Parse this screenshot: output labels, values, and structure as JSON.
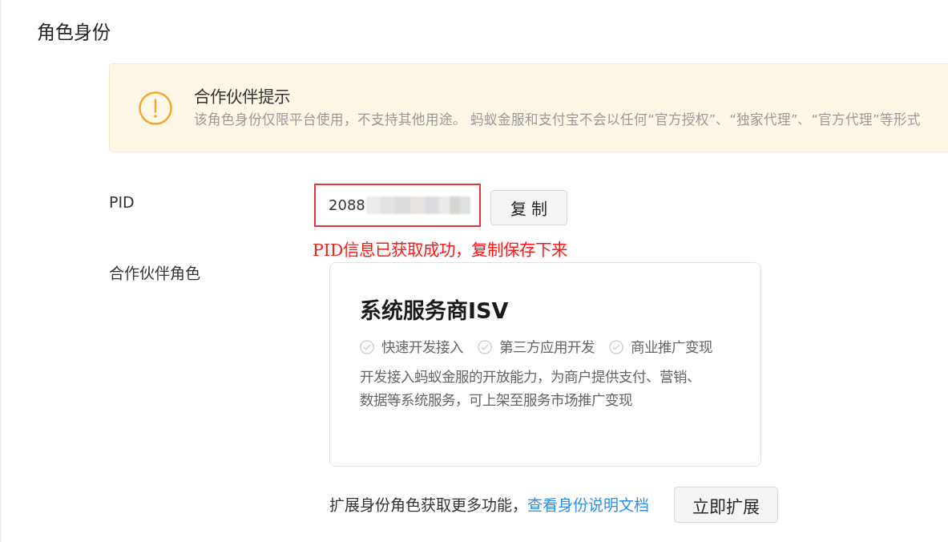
{
  "section": {
    "title": "角色身份"
  },
  "notice": {
    "kind": "warning",
    "title": "合作伙伴提示",
    "text": "该角色身份仅限平台使用，不支持其他用途。 蚂蚁金服和支付宝不会以任何“官方授权”、“独家代理”、“官方代理”等形式"
  },
  "pid": {
    "label": "PID",
    "value": "2088",
    "redacted": true,
    "highlighted": true,
    "copy_button": "复 制",
    "annotation": "PID信息已获取成功，复制保存下来"
  },
  "role": {
    "label": "合作伙伴角色",
    "card": {
      "title": "系统服务商ISV",
      "features": [
        "快速开发接入",
        "第三方应用开发",
        "商业推广变现"
      ],
      "description": "开发接入蚂蚁金服的开放能力，为商户提供支付、营销、数据等系统服务，可上架至服务市场推广变现"
    }
  },
  "footer": {
    "text": "扩展身份角色获取更多功能，",
    "link": "查看身份说明文档",
    "button": "立即扩展"
  }
}
